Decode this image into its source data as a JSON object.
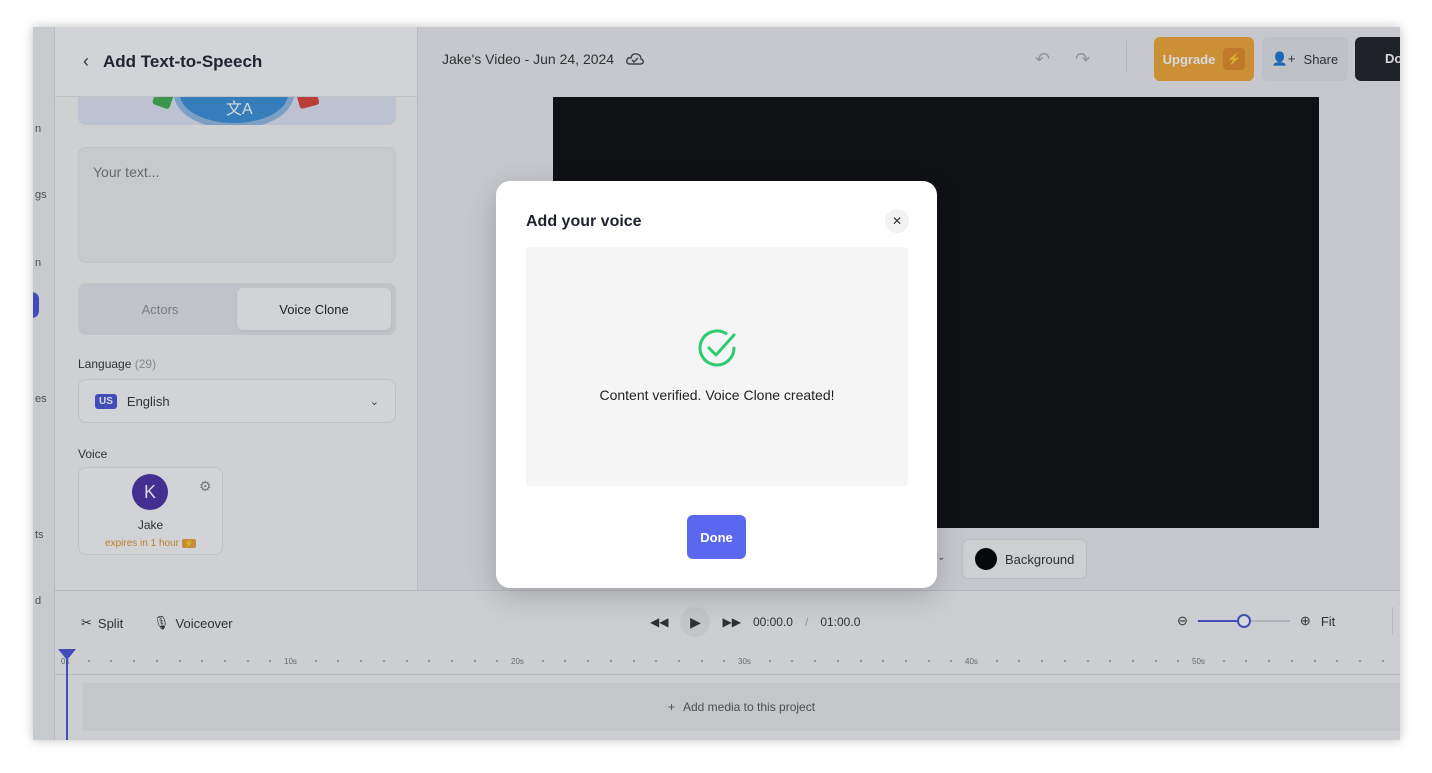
{
  "rail": {
    "labels": [
      "n",
      "gs",
      "n",
      "es",
      "ts",
      "d"
    ]
  },
  "panel": {
    "back_icon": "chevron-left-icon",
    "title": "Add Text-to-Speech",
    "text_placeholder": "Your text...",
    "tabs": [
      {
        "label": "Actors",
        "active": false
      },
      {
        "label": "Voice Clone",
        "active": true
      }
    ],
    "language_label": "Language",
    "language_count": "(29)",
    "language_flag": "US",
    "language_value": "English",
    "voice_label": "Voice",
    "voice": {
      "initial": "K",
      "name": "Jake",
      "expires": "expires in 1 hour"
    }
  },
  "header": {
    "project_title": "Jake's Video - Jun 24, 2024",
    "upgrade_label": "Upgrade",
    "share_label": "Share",
    "done_label": "Done"
  },
  "canvas": {
    "background_label": "Background",
    "background_color": "#000000"
  },
  "timeline": {
    "split_label": "Split",
    "voiceover_label": "Voiceover",
    "current_time": "00:00.0",
    "time_sep": "/",
    "total_time": "01:00.0",
    "fit_label": "Fit",
    "zoom_fraction": 0.5,
    "ticks": [
      "0s",
      "10s",
      "20s",
      "30s",
      "40s",
      "50s"
    ],
    "add_media_label": "Add media to this project"
  },
  "modal": {
    "title": "Add your voice",
    "message": "Content verified. Voice Clone created!",
    "done_label": "Done",
    "check_color": "#2ecc71"
  },
  "colors": {
    "accent": "#5a68ef",
    "upgrade": "#f0a637",
    "dark": "#1e2028"
  }
}
